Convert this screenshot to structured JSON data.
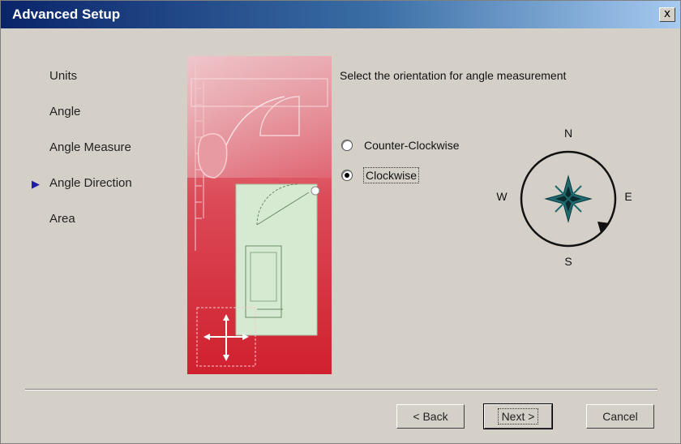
{
  "window": {
    "title": "Advanced Setup",
    "close_label": "x"
  },
  "steps": [
    {
      "label": "Units",
      "current": false
    },
    {
      "label": "Angle",
      "current": false
    },
    {
      "label": "Angle Measure",
      "current": false
    },
    {
      "label": "Angle Direction",
      "current": true
    },
    {
      "label": "Area",
      "current": false
    }
  ],
  "main": {
    "prompt": "Select the orientation for angle measurement",
    "options": [
      {
        "label": "Counter-Clockwise",
        "selected": false
      },
      {
        "label": "Clockwise",
        "selected": true
      }
    ]
  },
  "compass": {
    "n": "N",
    "e": "E",
    "s": "S",
    "w": "W"
  },
  "buttons": {
    "back": "< Back",
    "next": "Next >",
    "cancel": "Cancel"
  },
  "colors": {
    "title_bar": "#0a246a",
    "step_arrow": "#1c1ca8",
    "illustration_red": "#d22a3a",
    "compass_star": "#1e6a70"
  }
}
